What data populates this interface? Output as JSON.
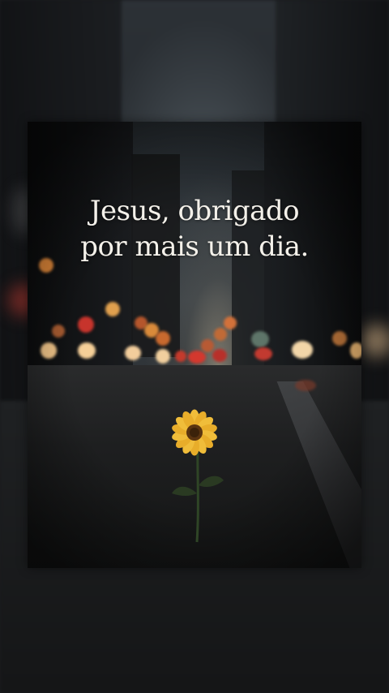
{
  "caption": {
    "line1": "Jesus, obrigado",
    "line2": "por mais um dia."
  },
  "colors": {
    "text": "#f4f1ea",
    "petal": "#e8ad2a",
    "flower_center": "#5a3410",
    "stem": "#2f4526",
    "bokeh_warm": "#f0a04a",
    "bokeh_red": "#d0342c"
  }
}
